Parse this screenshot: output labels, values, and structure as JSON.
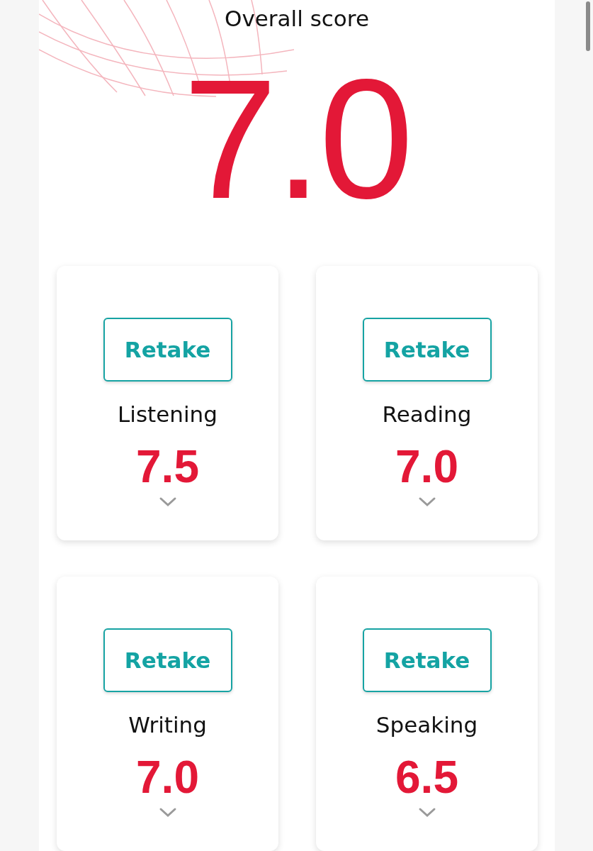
{
  "overall": {
    "label": "Overall score",
    "score": "7.0"
  },
  "sections": [
    {
      "name": "Listening",
      "score": "7.5",
      "button": "Retake"
    },
    {
      "name": "Reading",
      "score": "7.0",
      "button": "Retake"
    },
    {
      "name": "Writing",
      "score": "7.0",
      "button": "Retake"
    },
    {
      "name": "Speaking",
      "score": "6.5",
      "button": "Retake"
    }
  ]
}
